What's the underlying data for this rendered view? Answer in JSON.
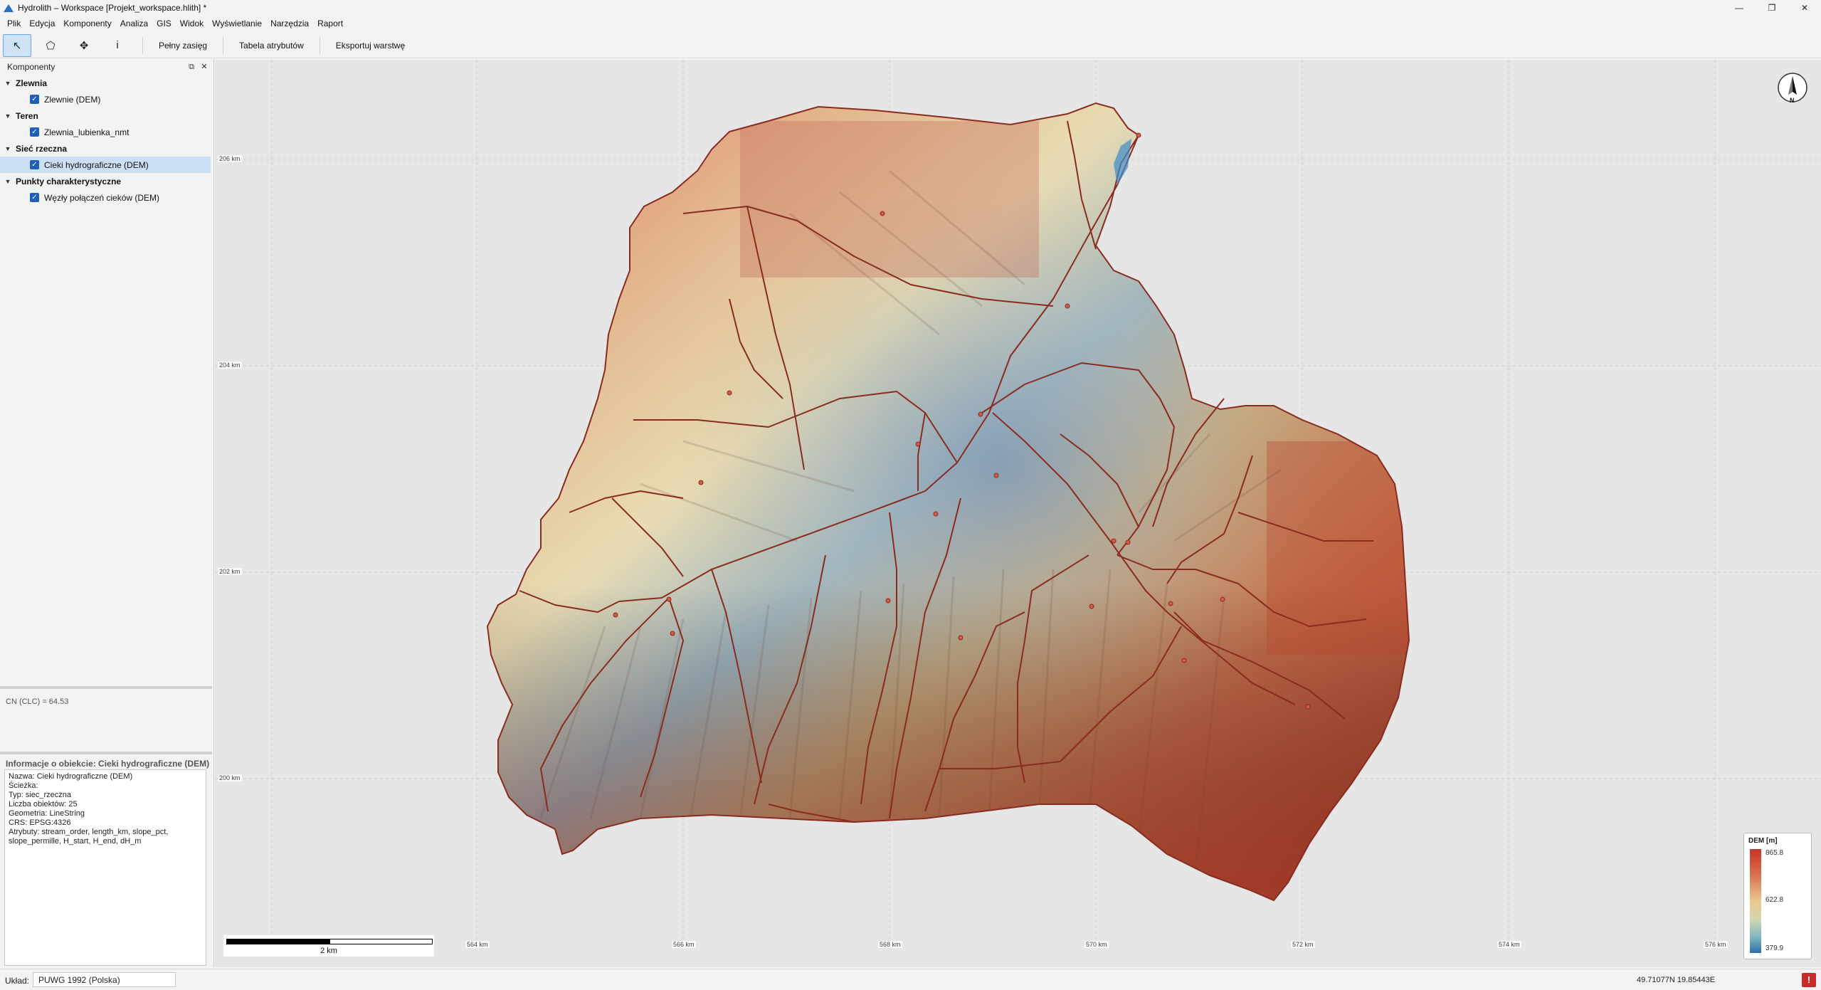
{
  "window": {
    "title": "Hydrolith – Workspace  [Projekt_workspace.hlith] *",
    "controls": [
      "—",
      "❐",
      "✕"
    ]
  },
  "menu": [
    "Plik",
    "Edycja",
    "Komponenty",
    "Analiza",
    "GIS",
    "Widok",
    "Wyświetlanie",
    "Narzędzia",
    "Raport"
  ],
  "toolbar": {
    "tools": [
      {
        "icon": "select-arrow-icon",
        "glyph": "↖",
        "active": true
      },
      {
        "icon": "polygon-icon",
        "glyph": "⬠",
        "active": false
      },
      {
        "icon": "pan-icon",
        "glyph": "✥",
        "active": false
      },
      {
        "icon": "info-icon",
        "glyph": "i",
        "active": false
      }
    ],
    "full_extent": "Pełny zasięg",
    "attribute_table": "Tabela atrybutów",
    "export_layers": "Eksportuj warstwę"
  },
  "components_panel": {
    "title": "Komponenty",
    "groups": [
      {
        "label": "Zlewnia",
        "items": [
          {
            "label": "Zlewnie (DEM)",
            "checked": true,
            "selected": false
          }
        ]
      },
      {
        "label": "Teren",
        "items": [
          {
            "label": "Zlewnia_lubienka_nmt",
            "checked": true,
            "selected": false
          }
        ]
      },
      {
        "label": "Sieć rzeczna",
        "items": [
          {
            "label": "Cieki hydrograficzne (DEM)",
            "checked": true,
            "selected": true
          }
        ]
      },
      {
        "label": "Punkty charakterystyczne",
        "items": [
          {
            "label": "Węzły połączeń cieków (DEM)",
            "checked": true,
            "selected": false
          }
        ]
      }
    ]
  },
  "cn_value": "CN (CLC) = 64.53",
  "object_info": {
    "title": "Informacje o obiekcie: Cieki hydrograficzne (DEM)",
    "lines": [
      "Nazwa: Cieki hydrograficzne (DEM)",
      "Ścieżka:",
      "Typ: siec_rzeczna",
      "Liczba obiektów: 25",
      "Geometria: LineString",
      "CRS: EPSG:4326",
      "Atrybuty: stream_order, length_km, slope_pct,",
      "slope_permille, H_start, H_end, dH_m"
    ]
  },
  "map": {
    "y_axis_labels": [
      "206 km",
      "204 km",
      "202 km",
      "200 km"
    ],
    "x_axis_labels": [
      "564 km",
      "566 km",
      "568 km",
      "570 km",
      "572 km",
      "574 km",
      "576 km"
    ],
    "north_label": "N",
    "scale_label": "2 km",
    "legend": {
      "title": "DEM [m]",
      "max": "865.8",
      "mid": "622.8",
      "min": "379.9"
    },
    "colors": {
      "low": "#2b6ea8",
      "mid": "#e9c98f",
      "high": "#c8332a",
      "stream": "#8a2b1f"
    }
  },
  "status": {
    "crs_label": "Układ:",
    "crs_value": "PUWG 1992 (Polska)",
    "coords": "49.71077N  19.85443E",
    "error_badge": "!"
  }
}
